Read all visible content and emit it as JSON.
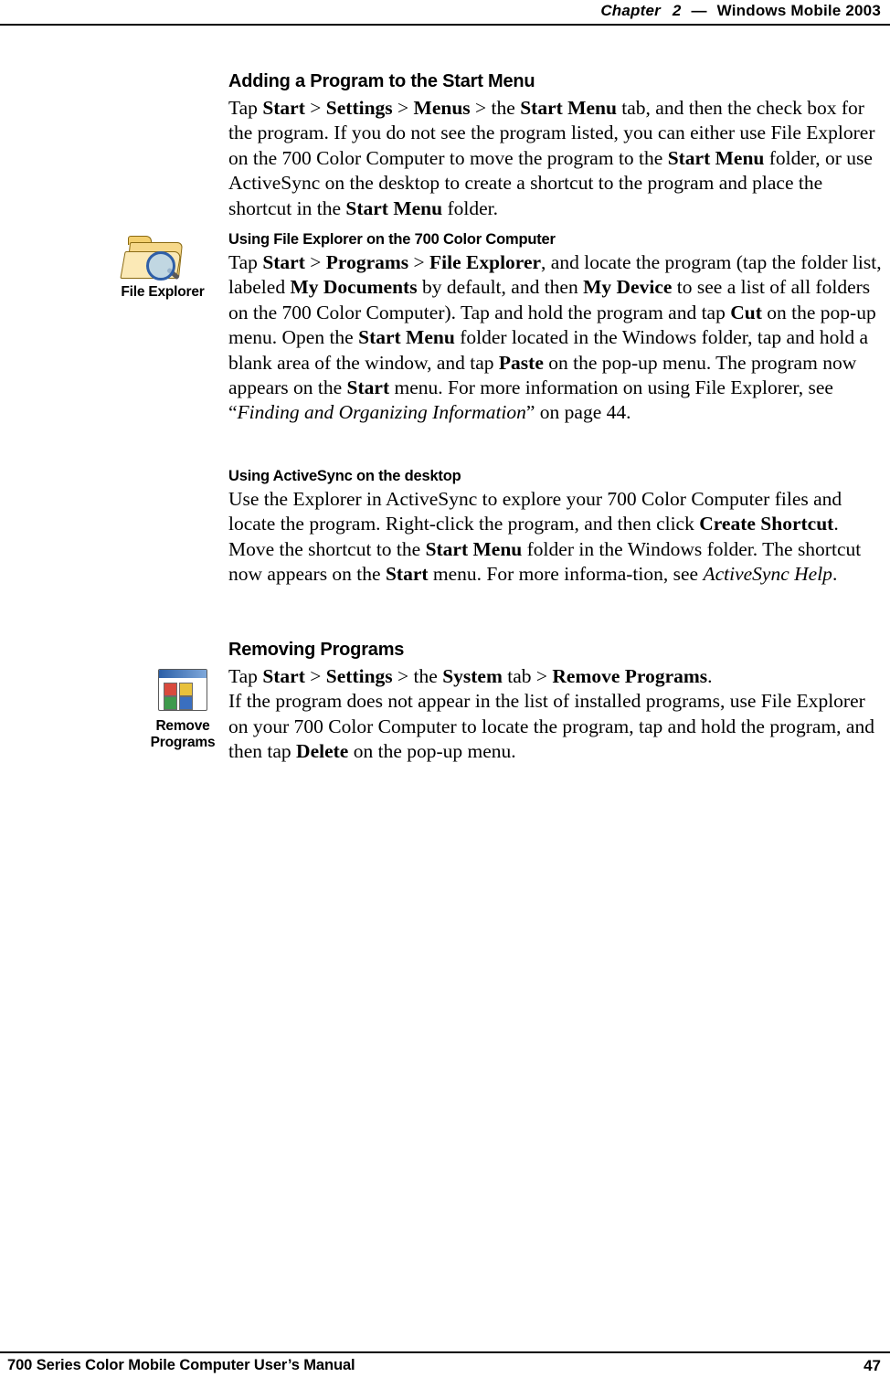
{
  "header": {
    "chapter_label": "Chapter",
    "chapter_number": "2",
    "dash": "—",
    "product": "Windows Mobile 2003"
  },
  "footer": {
    "manual_title": "700 Series Color Mobile Computer User’s Manual",
    "page_number": "47"
  },
  "sections": {
    "adding": {
      "title": "Adding a Program to the Start Menu",
      "body_1": "Tap ",
      "b_start": "Start",
      "sep1": " > ",
      "b_settings": "Settings",
      "sep2": " > ",
      "b_menus": "Menus",
      "sep3": " > the ",
      "b_startmenu": "Start Menu",
      "body_2": " tab, and then the check box for the program. If you do not see the program listed, you can either use File Explorer on the 700 Color Computer to move the program to the ",
      "b_startmenu2": "Start Menu",
      "body_3": " folder, or use ActiveSync on the desktop to create a shortcut to the program and place the shortcut in the ",
      "b_startmenu3": "Start Menu",
      "body_4": " folder."
    },
    "file_explorer": {
      "title": "Using File Explorer on the 700 Color Computer",
      "t1": "Tap ",
      "b1": "Start",
      "t2": " > ",
      "b2": "Programs",
      "t3": " > ",
      "b3": "File Explorer",
      "t4": ", and locate the program (tap the folder list, labeled ",
      "b4": "My Documents",
      "t5": " by default, and then ",
      "b5": "My Device",
      "t6": " to see a list of all folders on the 700 Color Computer). Tap and hold the program and tap ",
      "b6": "Cut",
      "t7": " on the pop-up menu. Open the ",
      "b7": "Start Menu",
      "t8": " folder located in the Windows folder, tap and hold a blank area of the window, and tap ",
      "b8": "Paste",
      "t9": " on the pop-up menu. The program now appears on the ",
      "b9": "Start",
      "t10": " menu. For more information on using File Explorer, see “",
      "i1": "Finding and Organizing Information",
      "t11": "” on page 44."
    },
    "activesync": {
      "title": "Using ActiveSync on the desktop",
      "t1": "Use the Explorer in ActiveSync to explore your 700 Color Computer files and locate the program. Right-click the program, and then click ",
      "b1": "Create Shortcut",
      "t2": ". Move the shortcut to the ",
      "b2": "Start Menu",
      "t3": " folder in the Windows folder. The shortcut now appears on the ",
      "b3": "Start",
      "t4": " menu. For more informa-tion, see ",
      "i1": "ActiveSync Help",
      "t5": "."
    },
    "removing": {
      "title": "Removing Programs",
      "p1_t1": "Tap ",
      "p1_b1": "Start",
      "p1_t2": " > ",
      "p1_b2": "Settings",
      "p1_t3": " > the ",
      "p1_b3": "System",
      "p1_t4": " tab > ",
      "p1_b4": "Remove Programs",
      "p1_t5": ".",
      "p2_t1": "If the program does not appear in the list of installed programs, use File Explorer on your 700 Color Computer to locate the program, tap and hold the program, and then tap ",
      "p2_b1": "Delete",
      "p2_t2": " on the pop-up menu."
    }
  },
  "margin_icons": {
    "file_explorer": {
      "caption": "File Explorer",
      "glyph": "folder-magnifier-icon"
    },
    "remove_programs": {
      "caption_line1": "Remove",
      "caption_line2": "Programs",
      "glyph": "remove-programs-icon"
    }
  }
}
